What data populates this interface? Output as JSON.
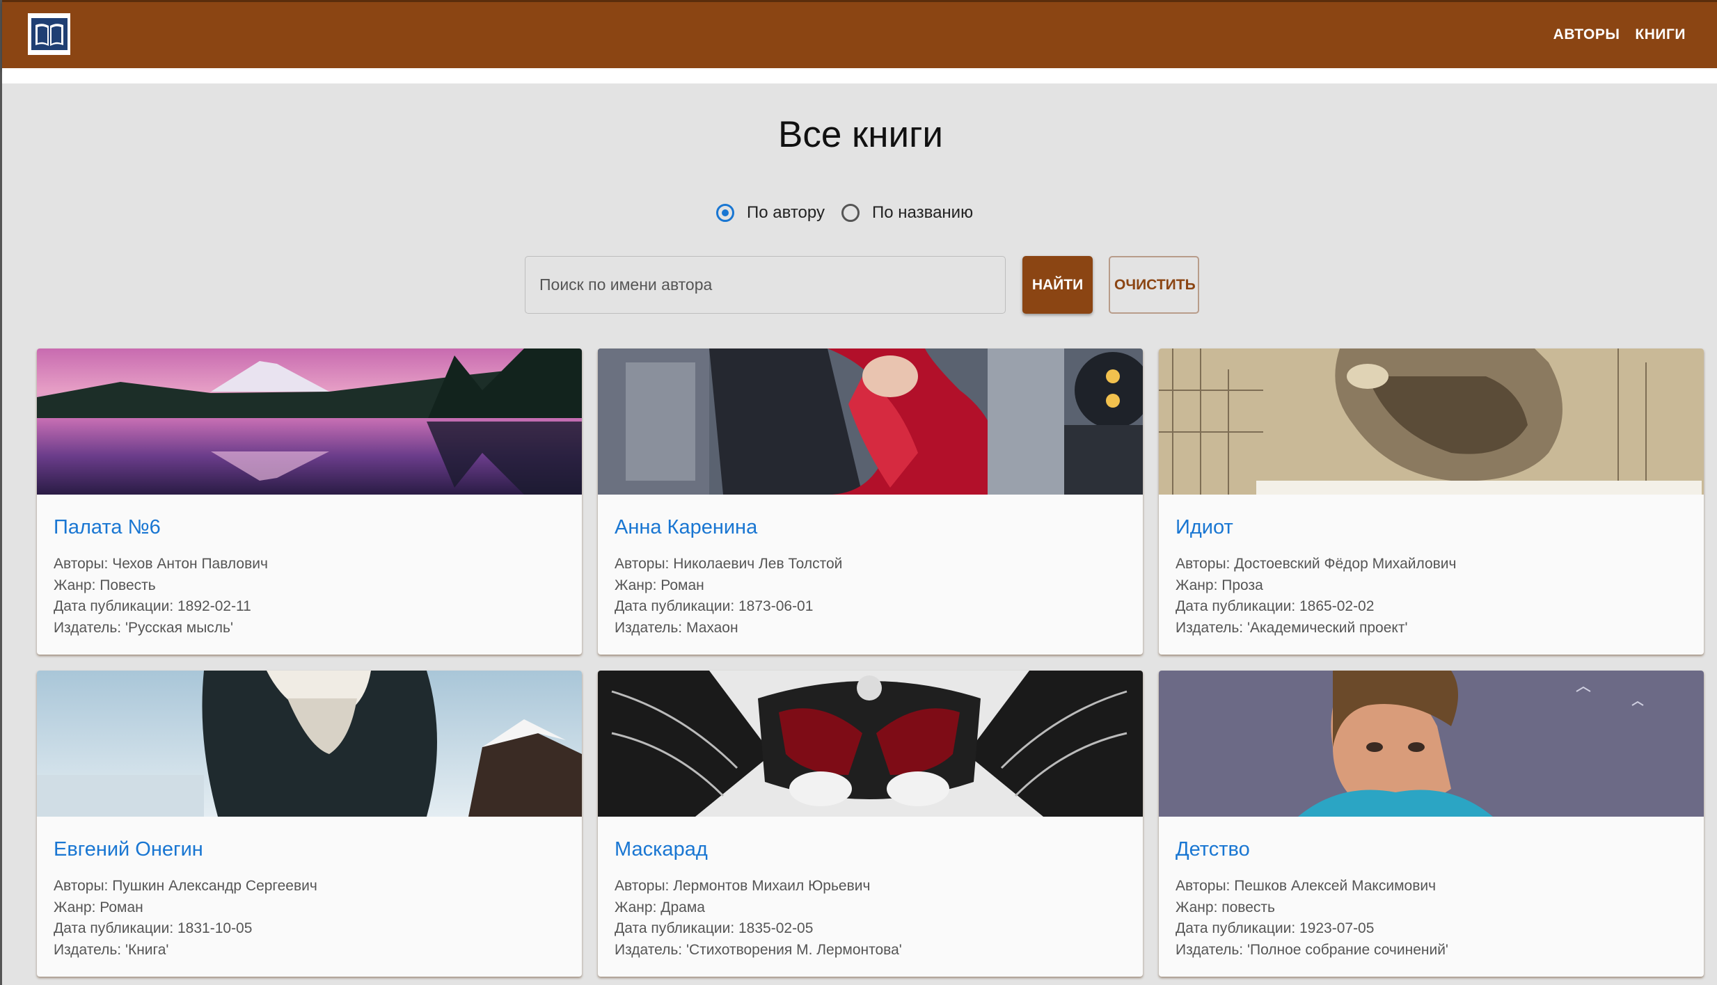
{
  "nav": {
    "authors": "АВТОРЫ",
    "books": "КНИГИ"
  },
  "page": {
    "title": "Все книги"
  },
  "search": {
    "by_author_label": "По автору",
    "by_title_label": "По названию",
    "selected": "by_author",
    "placeholder": "Поиск по имени автора",
    "find_label": "НАЙТИ",
    "clear_label": "ОЧИСТИТЬ"
  },
  "colors": {
    "brand": "#8b4513",
    "link": "#1976d2"
  },
  "books": [
    {
      "title": "Палата №6",
      "authors": "Авторы: Чехов Антон Павлович",
      "genre": "Жанр: Повесть",
      "date": "Дата публикации: 1892-02-11",
      "publisher": "Издатель: 'Русская мысль'"
    },
    {
      "title": "Анна Каренина",
      "authors": "Авторы: Николаевич Лев Толстой",
      "genre": "Жанр: Роман",
      "date": "Дата публикации: 1873-06-01",
      "publisher": "Издатель: Махаон"
    },
    {
      "title": "Идиот",
      "authors": "Авторы: Достоевский Фёдор Михайлович",
      "genre": "Жанр: Проза",
      "date": "Дата публикации: 1865-02-02",
      "publisher": "Издатель: 'Академический проект'"
    },
    {
      "title": "Евгений Онегин",
      "authors": "Авторы: Пушкин Александр Сергеевич",
      "genre": "Жанр: Роман",
      "date": "Дата публикации: 1831-10-05",
      "publisher": "Издатель: 'Книга'"
    },
    {
      "title": "Маскарад",
      "authors": "Авторы: Лермонтов Михаил Юрьевич",
      "genre": "Жанр: Драма",
      "date": "Дата публикации: 1835-02-05",
      "publisher": "Издатель: 'Стихотворения М. Лермонтова'"
    },
    {
      "title": "Детство",
      "authors": "Авторы: Пешков Алексей Максимович",
      "genre": "Жанр: повесть",
      "date": "Дата публикации: 1923-07-05",
      "publisher": "Издатель: 'Полное собрание сочинений'"
    }
  ]
}
